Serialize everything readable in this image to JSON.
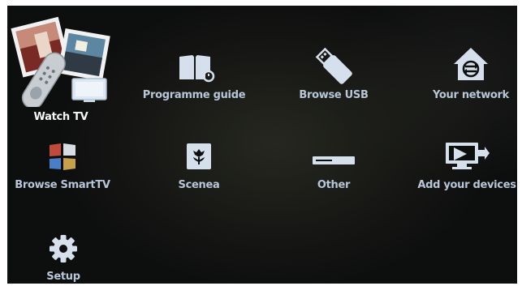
{
  "menu": {
    "items": [
      {
        "id": "watch_tv",
        "label": "Watch TV",
        "icon": "tv-remote-photos-icon",
        "selected": true
      },
      {
        "id": "programme_guide",
        "label": "Programme guide",
        "icon": "book-icon"
      },
      {
        "id": "browse_usb",
        "label": "Browse USB",
        "icon": "usb-stick-icon"
      },
      {
        "id": "your_network",
        "label": "Your network",
        "icon": "network-house-icon"
      },
      {
        "id": "browse_smarttv",
        "label": "Browse SmartTV",
        "icon": "smarttv-flag-icon"
      },
      {
        "id": "scenea",
        "label": "Scenea",
        "icon": "flower-icon"
      },
      {
        "id": "other",
        "label": "Other",
        "icon": "device-box-icon"
      },
      {
        "id": "add_devices",
        "label": "Add your devices",
        "icon": "add-device-icon"
      },
      {
        "id": "setup",
        "label": "Setup",
        "icon": "gear-icon"
      }
    ]
  },
  "colors": {
    "background": "#0d0e0e",
    "label": "#b8c6d8",
    "icon": "#d6e0ec",
    "selected_label": "#f4f6f8"
  }
}
